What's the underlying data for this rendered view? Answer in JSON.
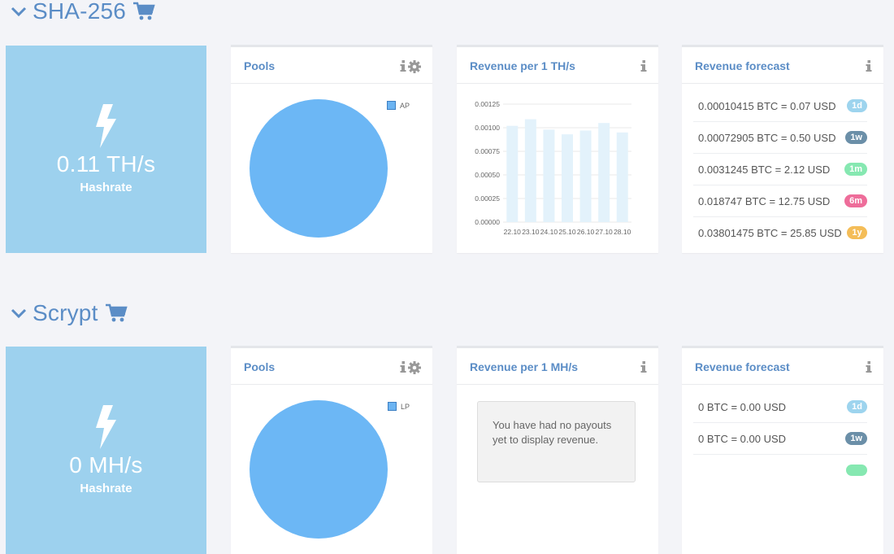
{
  "sections": [
    {
      "title": "SHA-256",
      "hashrate": {
        "value": "0.11 TH/s",
        "label": "Hashrate"
      },
      "pools": {
        "title": "Pools",
        "legend": "AP",
        "color": "#6cb7f5"
      },
      "revenue": {
        "title": "Revenue per 1 TH/s",
        "chart_data": {
          "type": "bar",
          "categories": [
            "22.10",
            "23.10",
            "24.10",
            "25.10",
            "26.10",
            "27.10",
            "28.10"
          ],
          "series": [
            {
              "values": [
                0.00102,
                0.00109,
                0.00098,
                0.00093,
                0.00097,
                0.00105,
                0.00095
              ]
            }
          ],
          "yticks": [
            "0.00000",
            "0.00025",
            "0.00050",
            "0.00075",
            "0.00100",
            "0.00125"
          ],
          "ylim": [
            0,
            0.00125
          ],
          "bar_color": "#e3f2fb"
        }
      },
      "forecast": {
        "title": "Revenue forecast",
        "rows": [
          {
            "text": "0.00010415 BTC = 0.07 USD",
            "badge": "1d",
            "color": "#9dd4ee"
          },
          {
            "text": "0.00072905 BTC = 0.50 USD",
            "badge": "1w",
            "color": "#6b8fa8"
          },
          {
            "text": "0.0031245 BTC = 2.12 USD",
            "badge": "1m",
            "color": "#86e8b1"
          },
          {
            "text": "0.018747 BTC = 12.75 USD",
            "badge": "6m",
            "color": "#ee6d9a"
          },
          {
            "text": "0.03801475 BTC = 25.85 USD",
            "badge": "1y",
            "color": "#f4bd58"
          }
        ]
      }
    },
    {
      "title": "Scrypt",
      "hashrate": {
        "value": "0 MH/s",
        "label": "Hashrate"
      },
      "pools": {
        "title": "Pools",
        "legend": "LP",
        "color": "#6cb7f5"
      },
      "revenue": {
        "title": "Revenue per 1 MH/s",
        "message": "You have had no payouts yet to display revenue."
      },
      "forecast": {
        "title": "Revenue forecast",
        "rows": [
          {
            "text": "0 BTC = 0.00 USD",
            "badge": "1d",
            "color": "#9dd4ee"
          },
          {
            "text": "0 BTC = 0.00 USD",
            "badge": "1w",
            "color": "#6b8fa8"
          },
          {
            "text": "",
            "badge": "",
            "color": "#86e8b1"
          }
        ]
      }
    }
  ],
  "icons": {
    "chevron": "chevron-down-icon",
    "cart": "shopping-cart-icon",
    "bolt": "lightning-bolt-icon",
    "info": "info-icon",
    "gear": "gear-icon"
  },
  "colors": {
    "accent": "#5b8dc6",
    "tile": "#9dd1ee",
    "background": "#f3f4f8"
  }
}
